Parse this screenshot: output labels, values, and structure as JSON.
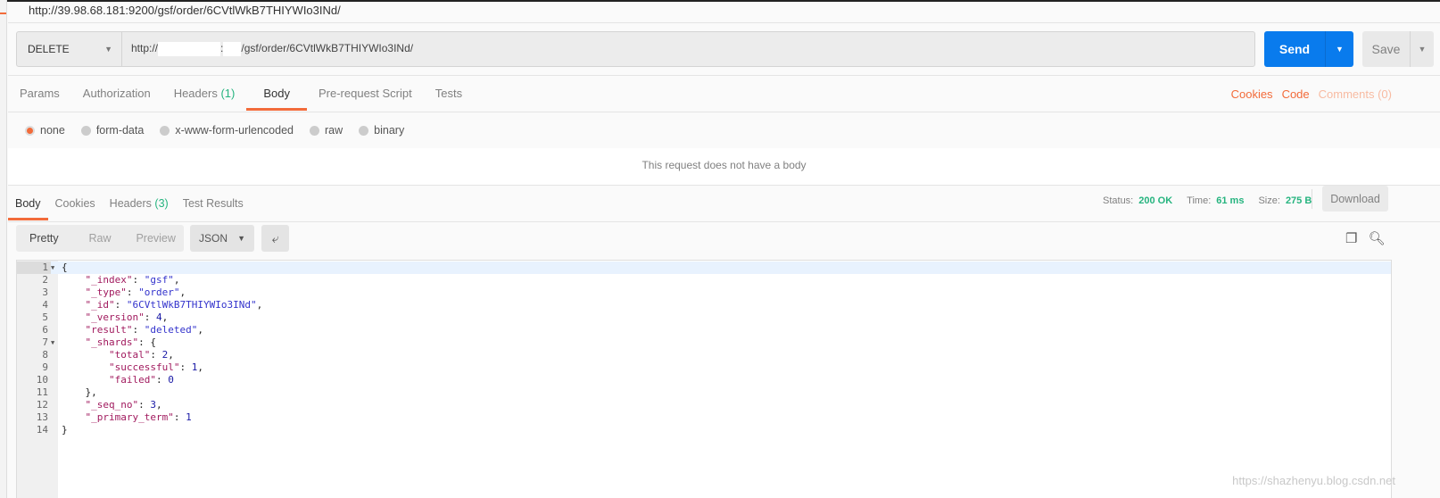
{
  "window_title": "http://39.98.68.181:9200/gsf/order/6CVtlWkB7THIYWIo3INd/",
  "request": {
    "method": "DELETE",
    "url_prefix": "http://",
    "url_sep": ":",
    "url_path": "/gsf/order/6CVtlWkB7THIYWIo3INd/",
    "send": "Send",
    "save": "Save"
  },
  "tabs": [
    {
      "label": "Params"
    },
    {
      "label": "Authorization"
    },
    {
      "label": "Headers",
      "count": "(1)"
    },
    {
      "label": "Body"
    },
    {
      "label": "Pre-request Script"
    },
    {
      "label": "Tests"
    }
  ],
  "right_links": {
    "cookies": "Cookies",
    "code": "Code",
    "comments": "Comments (0)"
  },
  "body_types": [
    "none",
    "form-data",
    "x-www-form-urlencoded",
    "raw",
    "binary"
  ],
  "body_selected": "none",
  "no_body_message": "This request does not have a body",
  "response_tabs": [
    {
      "label": "Body"
    },
    {
      "label": "Cookies"
    },
    {
      "label": "Headers",
      "count": "(3)"
    },
    {
      "label": "Test Results"
    }
  ],
  "status": {
    "status_label": "Status:",
    "status": "200 OK",
    "time_label": "Time:",
    "time": "61 ms",
    "size_label": "Size:",
    "size": "275 B",
    "download": "Download"
  },
  "view_modes": [
    "Pretty",
    "Raw",
    "Preview"
  ],
  "format": "JSON",
  "colors": {
    "accent": "#f26b3a",
    "send": "#097bed",
    "success": "#26b47f"
  },
  "code_lines": [
    [
      [
        "p",
        "{"
      ]
    ],
    [
      [
        "p",
        "    "
      ],
      [
        "k",
        "\"_index\""
      ],
      [
        "p",
        ": "
      ],
      [
        "s",
        "\"gsf\""
      ],
      [
        "p",
        ","
      ]
    ],
    [
      [
        "p",
        "    "
      ],
      [
        "k",
        "\"_type\""
      ],
      [
        "p",
        ": "
      ],
      [
        "s",
        "\"order\""
      ],
      [
        "p",
        ","
      ]
    ],
    [
      [
        "p",
        "    "
      ],
      [
        "k",
        "\"_id\""
      ],
      [
        "p",
        ": "
      ],
      [
        "s",
        "\"6CVtlWkB7THIYWIo3INd\""
      ],
      [
        "p",
        ","
      ]
    ],
    [
      [
        "p",
        "    "
      ],
      [
        "k",
        "\"_version\""
      ],
      [
        "p",
        ": "
      ],
      [
        "num",
        "4"
      ],
      [
        "p",
        ","
      ]
    ],
    [
      [
        "p",
        "    "
      ],
      [
        "k",
        "\"result\""
      ],
      [
        "p",
        ": "
      ],
      [
        "s",
        "\"deleted\""
      ],
      [
        "p",
        ","
      ]
    ],
    [
      [
        "p",
        "    "
      ],
      [
        "k",
        "\"_shards\""
      ],
      [
        "p",
        ": {"
      ]
    ],
    [
      [
        "p",
        "        "
      ],
      [
        "k",
        "\"total\""
      ],
      [
        "p",
        ": "
      ],
      [
        "num",
        "2"
      ],
      [
        "p",
        ","
      ]
    ],
    [
      [
        "p",
        "        "
      ],
      [
        "k",
        "\"successful\""
      ],
      [
        "p",
        ": "
      ],
      [
        "num",
        "1"
      ],
      [
        "p",
        ","
      ]
    ],
    [
      [
        "p",
        "        "
      ],
      [
        "k",
        "\"failed\""
      ],
      [
        "p",
        ": "
      ],
      [
        "num",
        "0"
      ]
    ],
    [
      [
        "p",
        "    },"
      ]
    ],
    [
      [
        "p",
        "    "
      ],
      [
        "k",
        "\"_seq_no\""
      ],
      [
        "p",
        ": "
      ],
      [
        "num",
        "3"
      ],
      [
        "p",
        ","
      ]
    ],
    [
      [
        "p",
        "    "
      ],
      [
        "k",
        "\"_primary_term\""
      ],
      [
        "p",
        ": "
      ],
      [
        "num",
        "1"
      ]
    ],
    [
      [
        "p",
        "}"
      ]
    ]
  ],
  "watermark": "https://shazhenyu.blog.csdn.net"
}
